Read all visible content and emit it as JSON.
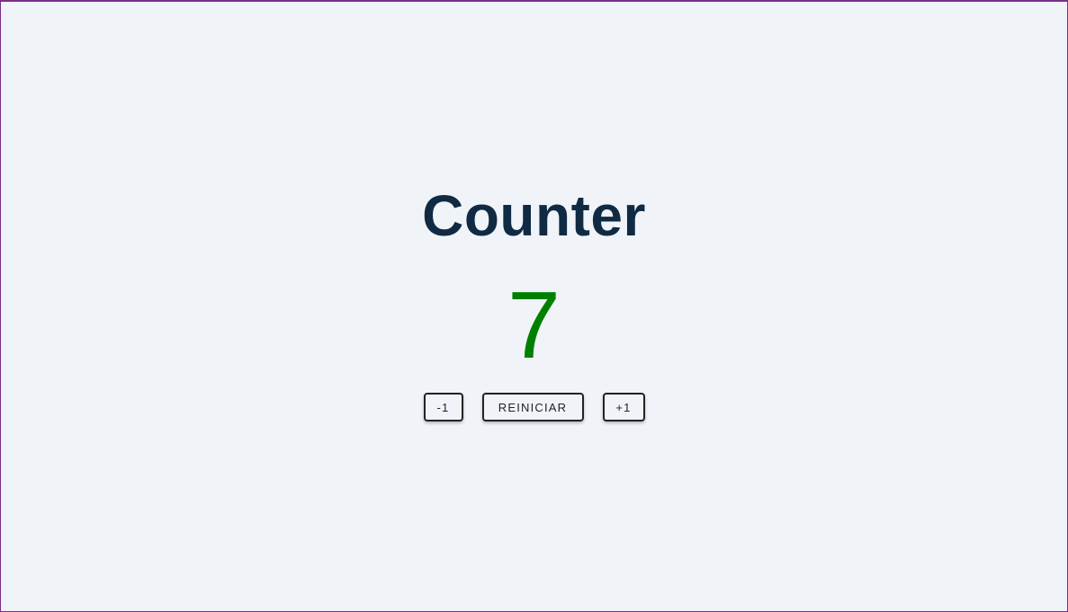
{
  "counter": {
    "title": "Counter",
    "value": "7",
    "value_color": "#008000",
    "buttons": {
      "decrement_label": "-1",
      "reset_label": "REINICIAR",
      "increment_label": "+1"
    }
  },
  "colors": {
    "background": "#f0f4f8",
    "title": "#102a43",
    "frame_border": "#7b2d8b"
  }
}
